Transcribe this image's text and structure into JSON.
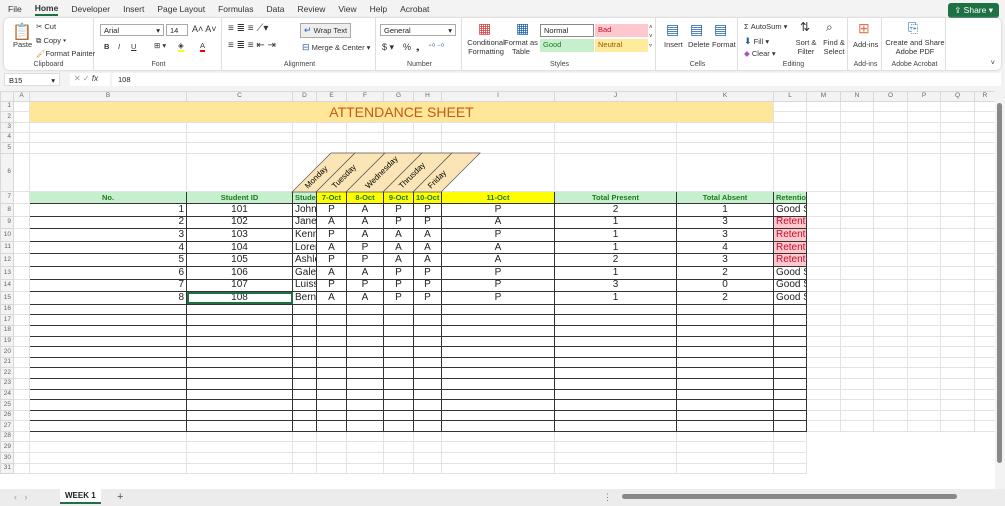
{
  "menu": {
    "tabs": [
      "File",
      "Home",
      "Developer",
      "Insert",
      "Page Layout",
      "Formulas",
      "Data",
      "Review",
      "View",
      "Help",
      "Acrobat"
    ],
    "active": "Home",
    "share": "Share"
  },
  "ribbon": {
    "clipboard": {
      "paste": "Paste",
      "cut": "Cut",
      "copy": "Copy",
      "format_painter": "Format Painter",
      "label": "Clipboard"
    },
    "font": {
      "name": "Arial",
      "size": "14",
      "label": "Font",
      "bold": "B",
      "italic": "I",
      "underline": "U"
    },
    "alignment": {
      "wrap": "Wrap Text",
      "merge": "Merge & Center",
      "label": "Alignment"
    },
    "number": {
      "format": "General",
      "label": "Number",
      "currency": "$",
      "percent": "%",
      "comma": "❟"
    },
    "styles": {
      "conditional": "Conditional Formatting",
      "format_table": "Format as Table",
      "normal": "Normal",
      "bad": "Bad",
      "good": "Good",
      "neutral": "Neutral",
      "label": "Styles"
    },
    "cells": {
      "insert": "Insert",
      "delete": "Delete",
      "format": "Format",
      "label": "Cells"
    },
    "editing": {
      "autosum": "AutoSum",
      "fill": "Fill",
      "clear": "Clear",
      "sort": "Sort & Filter",
      "find": "Find & Select",
      "label": "Editing"
    },
    "addins": {
      "button": "Add-ins",
      "label": "Add-ins"
    },
    "acrobat": {
      "button": "Create and Share Adobe PDF",
      "label": "Adobe Acrobat"
    }
  },
  "formula_bar": {
    "name_box": "B15",
    "fx": "fx",
    "value": "108"
  },
  "columns": [
    "A",
    "B",
    "C",
    "D",
    "E",
    "F",
    "G",
    "H",
    "I",
    "J",
    "K",
    "L",
    "M",
    "N",
    "O",
    "P",
    "Q",
    "R"
  ],
  "sheet": {
    "title": "ATTENDANCE SHEET",
    "days": [
      "Monday",
      "Tuesday",
      "Wednesday",
      "Thrusday",
      "Friday"
    ],
    "headers": [
      "No.",
      "Student ID",
      "Student Name",
      "7-Oct",
      "8-Oct",
      "9-Oct",
      "10-Oct",
      "11-Oct",
      "Total Present",
      "Total Absent",
      "Retention Status"
    ],
    "rows": [
      [
        "1",
        "101",
        "John Doe",
        "P",
        "A",
        "P",
        "P",
        "P",
        "2",
        "1",
        "Good Standing"
      ],
      [
        "2",
        "102",
        "Jane Smith",
        "A",
        "A",
        "P",
        "P",
        "A",
        "1",
        "3",
        "Retention"
      ],
      [
        "3",
        "103",
        "Kenny",
        "P",
        "A",
        "A",
        "A",
        "P",
        "1",
        "3",
        "Retention"
      ],
      [
        "4",
        "104",
        "Lorenso",
        "A",
        "P",
        "A",
        "A",
        "A",
        "1",
        "4",
        "Retention"
      ],
      [
        "5",
        "105",
        "Ashley",
        "P",
        "P",
        "A",
        "A",
        "A",
        "2",
        "3",
        "Retention"
      ],
      [
        "6",
        "106",
        "Gale",
        "A",
        "A",
        "P",
        "P",
        "P",
        "1",
        "2",
        "Good Standing"
      ],
      [
        "7",
        "107",
        "Luiss",
        "P",
        "P",
        "P",
        "P",
        "P",
        "3",
        "0",
        "Good Standing"
      ],
      [
        "8",
        "108",
        "Bernardo",
        "A",
        "A",
        "P",
        "P",
        "P",
        "1",
        "2",
        "Good Standing"
      ]
    ]
  },
  "sheet_tabs": [
    "WEEK 1"
  ],
  "colors": {
    "accent": "#1e7145",
    "header_fill": "#c6efce",
    "date_fill": "#ffff00",
    "retention_fill": "#ffc7ce",
    "title_fill": "#ffe699"
  }
}
